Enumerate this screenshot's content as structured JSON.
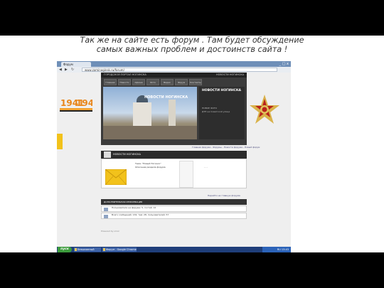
{
  "caption": {
    "line1": "Так же на сайте есть форум . Там будет обсуждение",
    "line2": "самых важных проблем и достоинств сайта !"
  },
  "browser": {
    "tab_title": "Форум",
    "address": "www.zaminoginsk.ru/forum/",
    "window_buttons": "_ □ x"
  },
  "site": {
    "top_left": "ГОРОДСКОЙ ПОРТАЛ НОГИНСКА",
    "top_right": "НОВОСТИ НОГИНСКА",
    "menu": [
      "Главная",
      "Новости",
      "Афиша",
      "Фото",
      "Видео",
      "Форум",
      "Контакты"
    ],
    "photo_caption": "НОВОСТИ НОГИНСКА",
    "side_title": "НОВОСТИ НОГИНСКА",
    "side_sub": "НОВОЕ ФОТО",
    "side_text": "ДТП на Советской улице",
    "breadcrumb": "Главная форума - Форумы - Новости форума - Новый форум",
    "forum_label": "НОВОСТИ НОГИНСКА",
    "forum_lines": [
      "Тема: \"Новый Ногинск\"",
      "Описание раздела форума"
    ],
    "forum_right": "- - -",
    "breadcrumb2": "Перейти на главную форума",
    "discuss_title": "ДОПОЛНИТЕЛЬНАЯ ИНФОРМАЦИЯ",
    "discuss_rows": [
      "Пользователи на форуме: 5, гостей: 12",
      "Всего сообщений: 134, тем: 28, пользователей: 57"
    ],
    "footer": "Powered by uCoz"
  },
  "taskbar": {
    "start": "пуск",
    "tasks": [
      "Безымянный",
      "Форум - Google Chrome"
    ],
    "clock": "RU 13:43"
  },
  "colors": {
    "accent": "#3b3b3b",
    "taskbar": "#1f3e7a",
    "start": "#3c9b3c"
  }
}
